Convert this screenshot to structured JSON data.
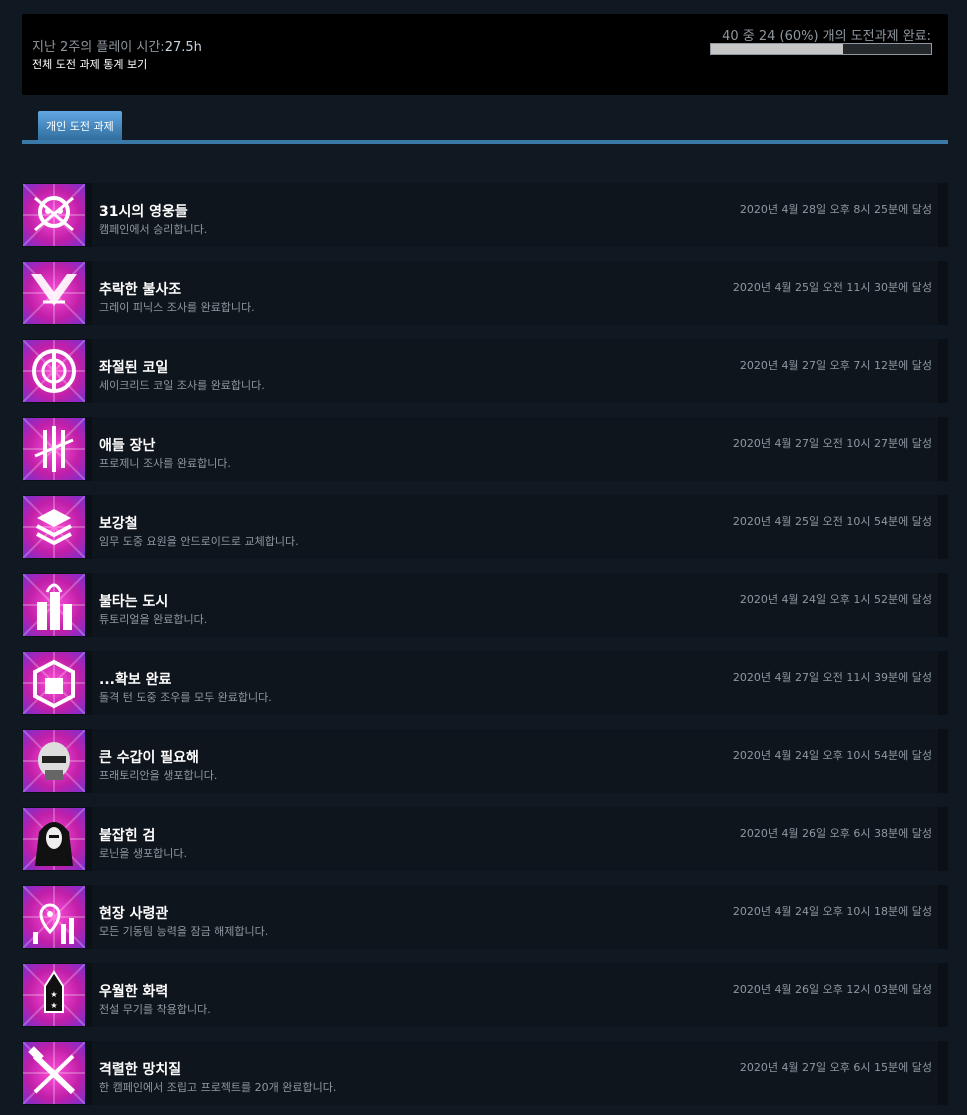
{
  "header": {
    "playtime_label": "지난 2주의 플레이 시간:",
    "playtime_value": "27.5h",
    "global_stats_link": "전체 도전 과제 통계 보기",
    "progress_text": "40 중 24 (60%) 개의 도전과제 완료:",
    "progress_fraction": 0.6
  },
  "tabs": {
    "personal": "개인 도전 과제"
  },
  "colors": {
    "accent": "#3b7aa8",
    "icon_magenta": "#c01fa8",
    "icon_purple": "#7a2fd0"
  },
  "achievements": [
    {
      "title": "31시의 영웅들",
      "desc": "캠페인에서 승리합니다.",
      "date": "2020년 4월 28일 오후 8시 25분에 달성",
      "icon": "skull-emblem-icon"
    },
    {
      "title": "추락한 불사조",
      "desc": "그레이 피닉스 조사를 완료합니다.",
      "date": "2020년 4월 25일 오전 11시 30분에 달성",
      "icon": "phoenix-emblem-icon"
    },
    {
      "title": "좌절된 코일",
      "desc": "세이크리드 코일 조사를 완료합니다.",
      "date": "2020년 4월 27일 오후 7시 12분에 달성",
      "icon": "coil-emblem-icon"
    },
    {
      "title": "애들 장난",
      "desc": "프로제니 조사를 완료합니다.",
      "date": "2020년 4월 27일 오전 10시 27분에 달성",
      "icon": "progeny-emblem-icon"
    },
    {
      "title": "보강철",
      "desc": "임무 도중 요원을 안드로이드로 교체합니다.",
      "date": "2020년 4월 25일 오전 10시 54분에 달성",
      "icon": "steel-stack-icon"
    },
    {
      "title": "불타는 도시",
      "desc": "튜토리얼을 완료합니다.",
      "date": "2020년 4월 24일 오후 1시 52분에 달성",
      "icon": "burning-city-icon"
    },
    {
      "title": "...확보 완료",
      "desc": "돌격 턴 도중 조우를 모두 완료합니다.",
      "date": "2020년 4월 27일 오전 11시 39분에 달성",
      "icon": "secured-box-icon"
    },
    {
      "title": "큰 수갑이 필요해",
      "desc": "프래토리안을 생포합니다.",
      "date": "2020년 4월 24일 오후 10시 54분에 달성",
      "icon": "armored-head-icon"
    },
    {
      "title": "붙잡힌 검",
      "desc": "로닌을 생포합니다.",
      "date": "2020년 4월 26일 오후 6시 38분에 달성",
      "icon": "hooded-figure-icon"
    },
    {
      "title": "현장 사령관",
      "desc": "모든 기동팀 능력을 잠금 해제합니다.",
      "date": "2020년 4월 24일 오후 10시 18분에 달성",
      "icon": "map-pin-city-icon"
    },
    {
      "title": "우월한 화력",
      "desc": "전설 무기를 착용합니다.",
      "date": "2020년 4월 26일 오후 12시 03분에 달성",
      "icon": "rocket-stars-icon"
    },
    {
      "title": "격렬한 망치질",
      "desc": "한 캠페인에서 조립고 프로젝트를 20개 완료합니다.",
      "date": "2020년 4월 27일 오후 6시 15분에 달성",
      "icon": "crossed-tools-icon"
    }
  ]
}
